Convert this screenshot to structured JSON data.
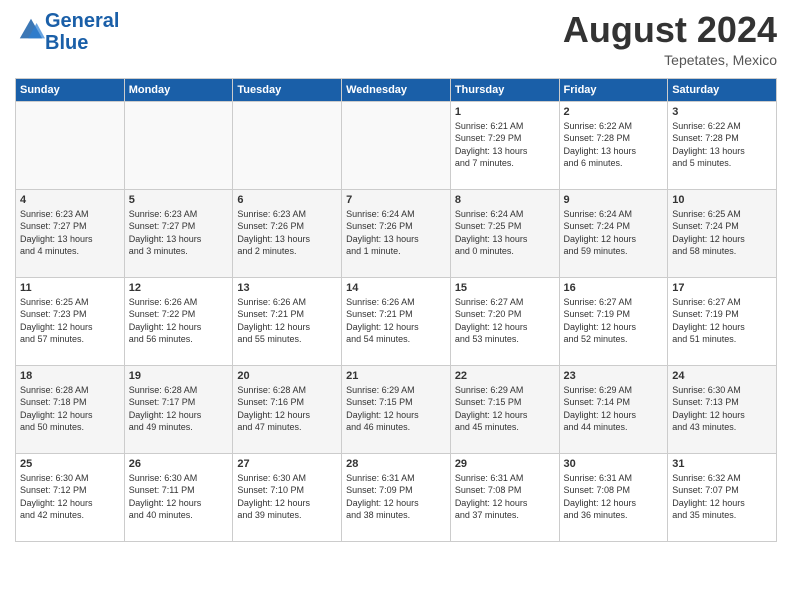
{
  "header": {
    "logo_general": "General",
    "logo_blue": "Blue",
    "month_title": "August 2024",
    "subtitle": "Tepetates, Mexico"
  },
  "weekdays": [
    "Sunday",
    "Monday",
    "Tuesday",
    "Wednesday",
    "Thursday",
    "Friday",
    "Saturday"
  ],
  "weeks": [
    [
      {
        "day": "",
        "info": ""
      },
      {
        "day": "",
        "info": ""
      },
      {
        "day": "",
        "info": ""
      },
      {
        "day": "",
        "info": ""
      },
      {
        "day": "1",
        "info": "Sunrise: 6:21 AM\nSunset: 7:29 PM\nDaylight: 13 hours\nand 7 minutes."
      },
      {
        "day": "2",
        "info": "Sunrise: 6:22 AM\nSunset: 7:28 PM\nDaylight: 13 hours\nand 6 minutes."
      },
      {
        "day": "3",
        "info": "Sunrise: 6:22 AM\nSunset: 7:28 PM\nDaylight: 13 hours\nand 5 minutes."
      }
    ],
    [
      {
        "day": "4",
        "info": "Sunrise: 6:23 AM\nSunset: 7:27 PM\nDaylight: 13 hours\nand 4 minutes."
      },
      {
        "day": "5",
        "info": "Sunrise: 6:23 AM\nSunset: 7:27 PM\nDaylight: 13 hours\nand 3 minutes."
      },
      {
        "day": "6",
        "info": "Sunrise: 6:23 AM\nSunset: 7:26 PM\nDaylight: 13 hours\nand 2 minutes."
      },
      {
        "day": "7",
        "info": "Sunrise: 6:24 AM\nSunset: 7:26 PM\nDaylight: 13 hours\nand 1 minute."
      },
      {
        "day": "8",
        "info": "Sunrise: 6:24 AM\nSunset: 7:25 PM\nDaylight: 13 hours\nand 0 minutes."
      },
      {
        "day": "9",
        "info": "Sunrise: 6:24 AM\nSunset: 7:24 PM\nDaylight: 12 hours\nand 59 minutes."
      },
      {
        "day": "10",
        "info": "Sunrise: 6:25 AM\nSunset: 7:24 PM\nDaylight: 12 hours\nand 58 minutes."
      }
    ],
    [
      {
        "day": "11",
        "info": "Sunrise: 6:25 AM\nSunset: 7:23 PM\nDaylight: 12 hours\nand 57 minutes."
      },
      {
        "day": "12",
        "info": "Sunrise: 6:26 AM\nSunset: 7:22 PM\nDaylight: 12 hours\nand 56 minutes."
      },
      {
        "day": "13",
        "info": "Sunrise: 6:26 AM\nSunset: 7:21 PM\nDaylight: 12 hours\nand 55 minutes."
      },
      {
        "day": "14",
        "info": "Sunrise: 6:26 AM\nSunset: 7:21 PM\nDaylight: 12 hours\nand 54 minutes."
      },
      {
        "day": "15",
        "info": "Sunrise: 6:27 AM\nSunset: 7:20 PM\nDaylight: 12 hours\nand 53 minutes."
      },
      {
        "day": "16",
        "info": "Sunrise: 6:27 AM\nSunset: 7:19 PM\nDaylight: 12 hours\nand 52 minutes."
      },
      {
        "day": "17",
        "info": "Sunrise: 6:27 AM\nSunset: 7:19 PM\nDaylight: 12 hours\nand 51 minutes."
      }
    ],
    [
      {
        "day": "18",
        "info": "Sunrise: 6:28 AM\nSunset: 7:18 PM\nDaylight: 12 hours\nand 50 minutes."
      },
      {
        "day": "19",
        "info": "Sunrise: 6:28 AM\nSunset: 7:17 PM\nDaylight: 12 hours\nand 49 minutes."
      },
      {
        "day": "20",
        "info": "Sunrise: 6:28 AM\nSunset: 7:16 PM\nDaylight: 12 hours\nand 47 minutes."
      },
      {
        "day": "21",
        "info": "Sunrise: 6:29 AM\nSunset: 7:15 PM\nDaylight: 12 hours\nand 46 minutes."
      },
      {
        "day": "22",
        "info": "Sunrise: 6:29 AM\nSunset: 7:15 PM\nDaylight: 12 hours\nand 45 minutes."
      },
      {
        "day": "23",
        "info": "Sunrise: 6:29 AM\nSunset: 7:14 PM\nDaylight: 12 hours\nand 44 minutes."
      },
      {
        "day": "24",
        "info": "Sunrise: 6:30 AM\nSunset: 7:13 PM\nDaylight: 12 hours\nand 43 minutes."
      }
    ],
    [
      {
        "day": "25",
        "info": "Sunrise: 6:30 AM\nSunset: 7:12 PM\nDaylight: 12 hours\nand 42 minutes."
      },
      {
        "day": "26",
        "info": "Sunrise: 6:30 AM\nSunset: 7:11 PM\nDaylight: 12 hours\nand 40 minutes."
      },
      {
        "day": "27",
        "info": "Sunrise: 6:30 AM\nSunset: 7:10 PM\nDaylight: 12 hours\nand 39 minutes."
      },
      {
        "day": "28",
        "info": "Sunrise: 6:31 AM\nSunset: 7:09 PM\nDaylight: 12 hours\nand 38 minutes."
      },
      {
        "day": "29",
        "info": "Sunrise: 6:31 AM\nSunset: 7:08 PM\nDaylight: 12 hours\nand 37 minutes."
      },
      {
        "day": "30",
        "info": "Sunrise: 6:31 AM\nSunset: 7:08 PM\nDaylight: 12 hours\nand 36 minutes."
      },
      {
        "day": "31",
        "info": "Sunrise: 6:32 AM\nSunset: 7:07 PM\nDaylight: 12 hours\nand 35 minutes."
      }
    ]
  ]
}
